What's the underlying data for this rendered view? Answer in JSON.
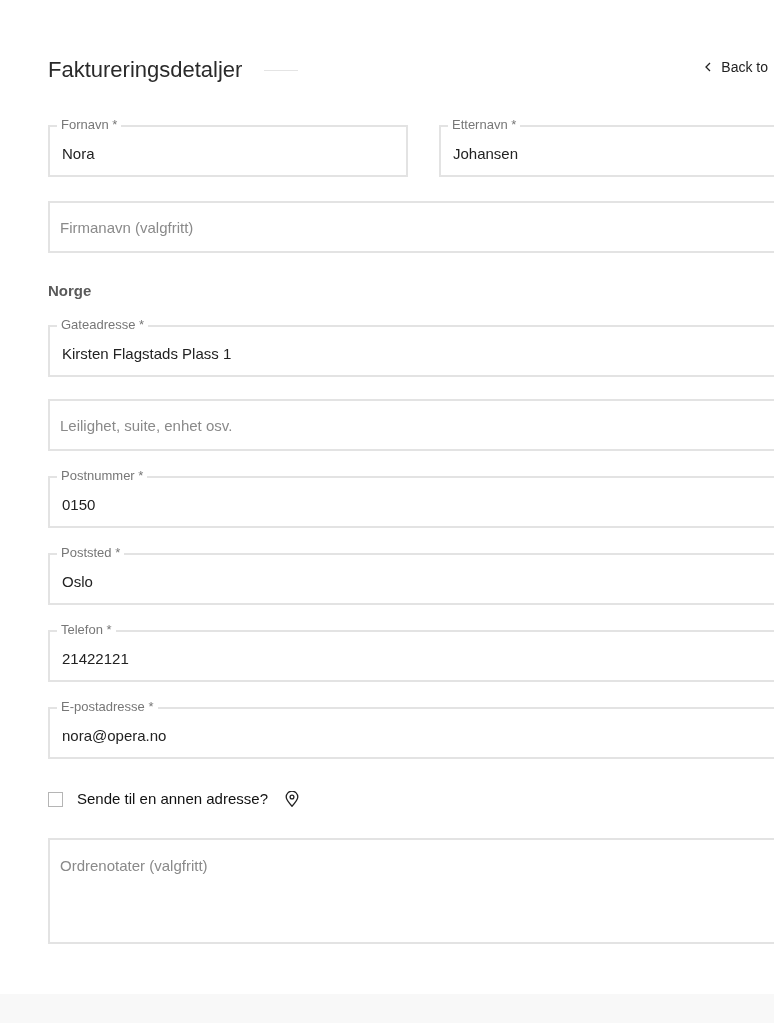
{
  "header": {
    "title": "Faktureringsdetaljer",
    "back_link": "Back to"
  },
  "name_fields": [
    {
      "label": "Fornavn *",
      "value": "Nora"
    },
    {
      "label": "Etternavn *",
      "value": "Johansen"
    }
  ],
  "company_field": {
    "placeholder": "Firmanavn (valgfritt)"
  },
  "country": "Norge",
  "address_fields": [
    {
      "label": "Gateadresse *",
      "value": "Kirsten Flagstads Plass 1"
    },
    {
      "placeholder": "Leilighet, suite, enhet osv."
    },
    {
      "label": "Postnummer *",
      "value": "0150"
    },
    {
      "label": "Poststed *",
      "value": "Oslo"
    },
    {
      "label": "Telefon *",
      "value": "21422121"
    },
    {
      "label": "E-postadresse *",
      "value": "nora@opera.no"
    }
  ],
  "ship_to_different": {
    "label": "Sende til en annen adresse?",
    "checked": false
  },
  "order_notes": {
    "placeholder": "Ordrenotater (valgfritt)"
  }
}
